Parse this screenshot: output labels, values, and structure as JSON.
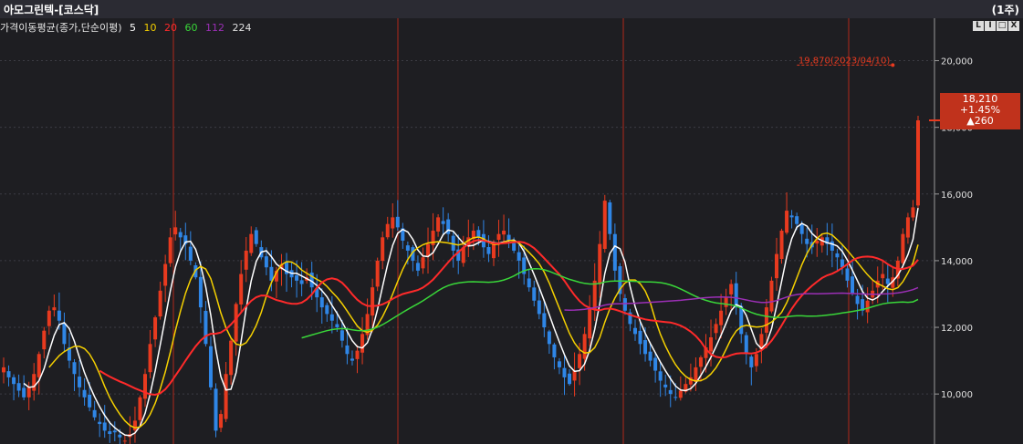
{
  "window": {
    "title": "아모그린텍-[코스닥]",
    "period": "(1주)"
  },
  "legend": {
    "name": "가격이동평균(종가,단순이평)",
    "periods": [
      {
        "label": "5",
        "color": "#ffffff"
      },
      {
        "label": "10",
        "color": "#f5d000"
      },
      {
        "label": "20",
        "color": "#ff2a2a"
      },
      {
        "label": "60",
        "color": "#39d639"
      },
      {
        "label": "112",
        "color": "#9b2fb5"
      },
      {
        "label": "224",
        "color": "#e0e0e0"
      }
    ]
  },
  "controls": [
    "L",
    "I",
    "□",
    "X"
  ],
  "price_tag": {
    "price": "18,210",
    "change_pct": "+1.45%",
    "change": "▲260"
  },
  "chart_data": {
    "type": "candlestick",
    "y_range": [
      8500,
      21000
    ],
    "y_ticks": [
      {
        "value": 10000,
        "label": "10,000"
      },
      {
        "value": 12000,
        "label": "12,000"
      },
      {
        "value": 14000,
        "label": "14,000"
      },
      {
        "value": 16000,
        "label": "16,000"
      },
      {
        "value": 18000,
        "label": "18,000"
      },
      {
        "value": 20000,
        "label": "20,000"
      }
    ],
    "colors": {
      "up": "#e83a1f",
      "down": "#2f86e6"
    },
    "current_price": 18210,
    "max_annotation": {
      "label": "19,870(2023/04/10)",
      "value": 19870
    },
    "closes": [
      10800,
      10500,
      10300,
      10100,
      9900,
      10200,
      10600,
      11200,
      11900,
      12500,
      12600,
      12200,
      11500,
      11000,
      10600,
      10200,
      9900,
      9600,
      9300,
      9100,
      8900,
      8800,
      8850,
      8700,
      8600,
      8800,
      9200,
      9900,
      10600,
      11500,
      12300,
      13100,
      13900,
      14700,
      15000,
      14700,
      14500,
      14000,
      13500,
      12600,
      11500,
      10200,
      8900,
      9400,
      10600,
      11600,
      12700,
      13600,
      14300,
      14800,
      14500,
      14100,
      13800,
      13400,
      13700,
      13900,
      13600,
      13500,
      13400,
      13300,
      13500,
      13200,
      12900,
      12600,
      12400,
      12200,
      12000,
      11600,
      11200,
      11000,
      11300,
      11800,
      12400,
      13200,
      14000,
      14700,
      15100,
      15300,
      15000,
      14600,
      14300,
      14000,
      13700,
      14100,
      14500,
      14900,
      15300,
      15100,
      14800,
      14300,
      14000,
      14400,
      14700,
      14900,
      14700,
      14400,
      14200,
      14500,
      14800,
      14900,
      14600,
      14300,
      14000,
      13600,
      13200,
      12800,
      12400,
      12000,
      11500,
      11100,
      10800,
      10500,
      10300,
      10700,
      11200,
      11800,
      12600,
      13400,
      14500,
      15800,
      14800,
      13700,
      13000,
      12500,
      12100,
      11800,
      11500,
      11200,
      11000,
      10700,
      10400,
      10200,
      10000,
      9900,
      10100,
      10300,
      10500,
      10800,
      11100,
      11400,
      11700,
      12100,
      12500,
      12900,
      13300,
      12600,
      11800,
      11200,
      10800,
      11200,
      11800,
      12600,
      13400,
      14200,
      14900,
      15500,
      15300,
      15100,
      14800,
      14500,
      14400,
      14600,
      14700,
      14500,
      14300,
      14100,
      13800,
      13400,
      13000,
      12700,
      12500,
      12800,
      13100,
      13400,
      13600,
      13300,
      13500,
      14000,
      14800,
      15300,
      15600,
      18210
    ]
  }
}
